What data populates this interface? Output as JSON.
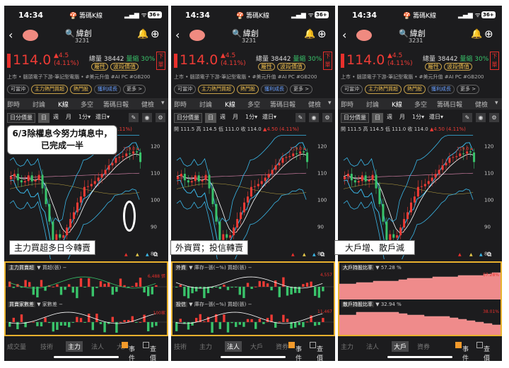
{
  "status": {
    "time": "14:34",
    "app": "籌碼K線",
    "battery": "36+"
  },
  "stock": {
    "name": "緯創",
    "code": "3231",
    "price": "114.0",
    "change": "▲4.5",
    "pct": "(4.11%)",
    "volume_label": "總量",
    "volume": "38442",
    "vol_tag": "量縮",
    "vol_pct": "30%",
    "attr_label": "屬性",
    "attr_value": "波段價值",
    "order": "下單",
    "tags": "上市 • 腦頭電子下游-筆記型電腦 • #美元升值 #AI PC #GB200",
    "pills": [
      "可當沖",
      "主力熱門買超",
      "熱門股",
      "獲利成長",
      "更多 >"
    ]
  },
  "nav_tabs": [
    "即時",
    "討論",
    "K線",
    "多空",
    "籌碼日報",
    "健檢"
  ],
  "controls": {
    "period": "日分價量",
    "d": "日",
    "w": "週",
    "m": "月",
    "min": "1分",
    "dk": "還日"
  },
  "ohlc": {
    "text": "開 111.5 高 114.5 低 111.0 收 114.0",
    "chg": "▲4.50 (4.11%)"
  },
  "axis": {
    "labels": [
      "120",
      "110",
      "100",
      "90",
      "80"
    ],
    "high_label": "119.0"
  },
  "panels": [
    {
      "sub_top": "主力買賣超",
      "sub_top_unit": "買超(張) −",
      "sub_top_scale": "6,488 張",
      "sub_bot": "買賣家數差",
      "sub_bot_unit": "家數差 −",
      "sub_bot_scale": "100家",
      "bottom_tabs": [
        "成交量",
        "技術",
        "主力",
        "法人",
        "大戶"
      ],
      "active_tab": "主力"
    },
    {
      "sub_top": "外資",
      "sub_top_unit": "庫存−張(~%) 買超(張) −",
      "sub_top_scale": "4,557",
      "sub_bot": "投信",
      "sub_bot_unit": "庫存−張(~%) 買超(張) −",
      "sub_bot_scale": "11,467",
      "bottom_tabs": [
        "技術",
        "主力",
        "法人",
        "大戶",
        "資券"
      ],
      "active_tab": "法人"
    },
    {
      "sub_top": "大戶持股比率",
      "sub_top_unit": "57.28 %",
      "sub_top_scale": "57.28%",
      "sub_bot": "散戶持股比率",
      "sub_bot_unit": "32.94 %",
      "sub_bot_scale": "38.01%",
      "bottom_tabs": [
        "主力",
        "法人",
        "大戶",
        "資券"
      ],
      "active_tab": "大戶"
    }
  ],
  "events": {
    "event": "事件",
    "show": "查價線"
  },
  "annotations": {
    "a1_l1": "6/3除權息今努力填息中，",
    "a1_l2": "已完成一半",
    "a2": "主力買超多日今轉賣",
    "a3": "外資買；投信轉賣",
    "a4": "大戶增、散戶減"
  },
  "colors": {
    "up": "#ee3b35",
    "down": "#39c36a",
    "accent": "#e8b12d",
    "ma_blue": "#3ab7e8",
    "ma_pink": "#e48ab4",
    "ma_yellow": "#e5c84a",
    "ma_white": "#ffffff"
  }
}
